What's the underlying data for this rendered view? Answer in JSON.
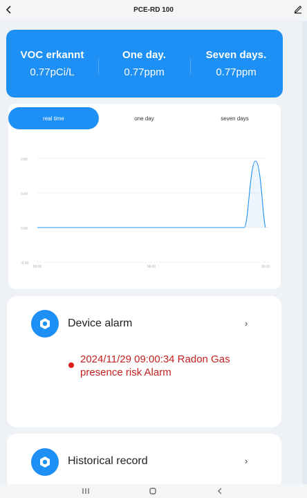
{
  "header": {
    "title": "PCE-RD 100"
  },
  "stats": [
    {
      "label": "VOC erkannt",
      "value": "0.77pCi/L"
    },
    {
      "label": "One day.",
      "value": "0.77ppm"
    },
    {
      "label": "Seven days.",
      "value": "0.77ppm"
    }
  ],
  "tabs": [
    {
      "label": "real time"
    },
    {
      "label": "one day"
    },
    {
      "label": "seven days"
    }
  ],
  "chart_data": {
    "type": "area",
    "y_ticks": [
      "0.80",
      "0.40",
      "0.00",
      "-0.40"
    ],
    "x_ticks": [
      "00:00",
      "08:00",
      "16:00"
    ],
    "ylim": [
      -0.4,
      0.8
    ],
    "xlim": [
      0,
      16
    ],
    "grid": true,
    "color": "#1e90f5",
    "points": [
      {
        "x": 0,
        "y": 0
      },
      {
        "x": 14.5,
        "y": 0
      },
      {
        "x": 15.3,
        "y": 0.77
      },
      {
        "x": 16.0,
        "y": 0
      }
    ]
  },
  "alarm_card": {
    "label": "Device alarm",
    "chevron": "›",
    "message": "2024/11/29 09:00:34 Radon Gas presence risk Alarm"
  },
  "history_card": {
    "label": "Historical record",
    "chevron": "›"
  },
  "colors": {
    "accent": "#1e90f5",
    "alarm": "#c62020"
  }
}
